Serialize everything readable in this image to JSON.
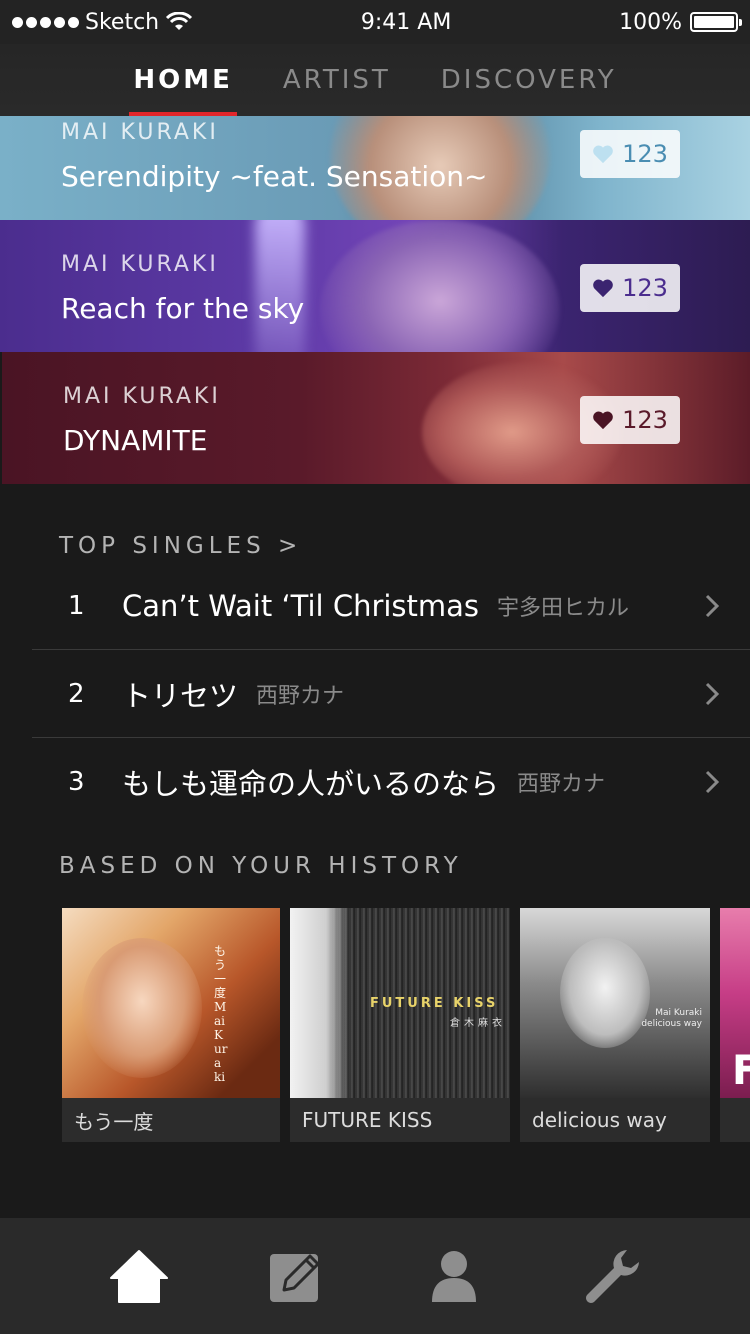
{
  "status_bar": {
    "carrier": "Sketch",
    "time": "9:41 AM",
    "battery": "100%"
  },
  "top_tabs": [
    {
      "label": "HOME",
      "active": true
    },
    {
      "label": "ARTIST",
      "active": false
    },
    {
      "label": "DISCOVERY",
      "active": false
    }
  ],
  "featured": [
    {
      "artist": "MAI KURAKI",
      "song": "Serendipity ~feat. Sensation~",
      "likes": "123"
    },
    {
      "artist": "MAI KURAKI",
      "song": "Reach for the sky",
      "likes": "123"
    },
    {
      "artist": "MAI KURAKI",
      "song": "DYNAMITE",
      "likes": "123"
    }
  ],
  "top_singles": {
    "title": "TOP SINGLES >",
    "items": [
      {
        "rank": "1",
        "title": "Can’t Wait ‘Til Christmas",
        "artist": "宇多田ヒカル"
      },
      {
        "rank": "2",
        "title": "トリセツ",
        "artist": "西野カナ"
      },
      {
        "rank": "3",
        "title": "もしも運命の人がいるのなら",
        "artist": "西野カナ"
      }
    ]
  },
  "history": {
    "title": "BASED ON YOUR HISTORY",
    "albums": [
      {
        "label": "もう一度",
        "cover_text": "もう一度 Mai Kuraki"
      },
      {
        "label": "FUTURE KISS",
        "cover_text": "FUTURE KISS",
        "cover_subtext": "倉木麻衣"
      },
      {
        "label": "delicious way",
        "cover_text": "Mai Kuraki delicious way"
      },
      {
        "label": "",
        "cover_text": "F"
      }
    ]
  },
  "tabbar": [
    {
      "icon": "home-icon",
      "active": true
    },
    {
      "icon": "pencil-icon",
      "active": false
    },
    {
      "icon": "person-icon",
      "active": false
    },
    {
      "icon": "wrench-icon",
      "active": false
    }
  ],
  "colors": {
    "accent": "#e2262b",
    "background": "#1a1a1a",
    "tabbar": "#2a2a2a"
  }
}
